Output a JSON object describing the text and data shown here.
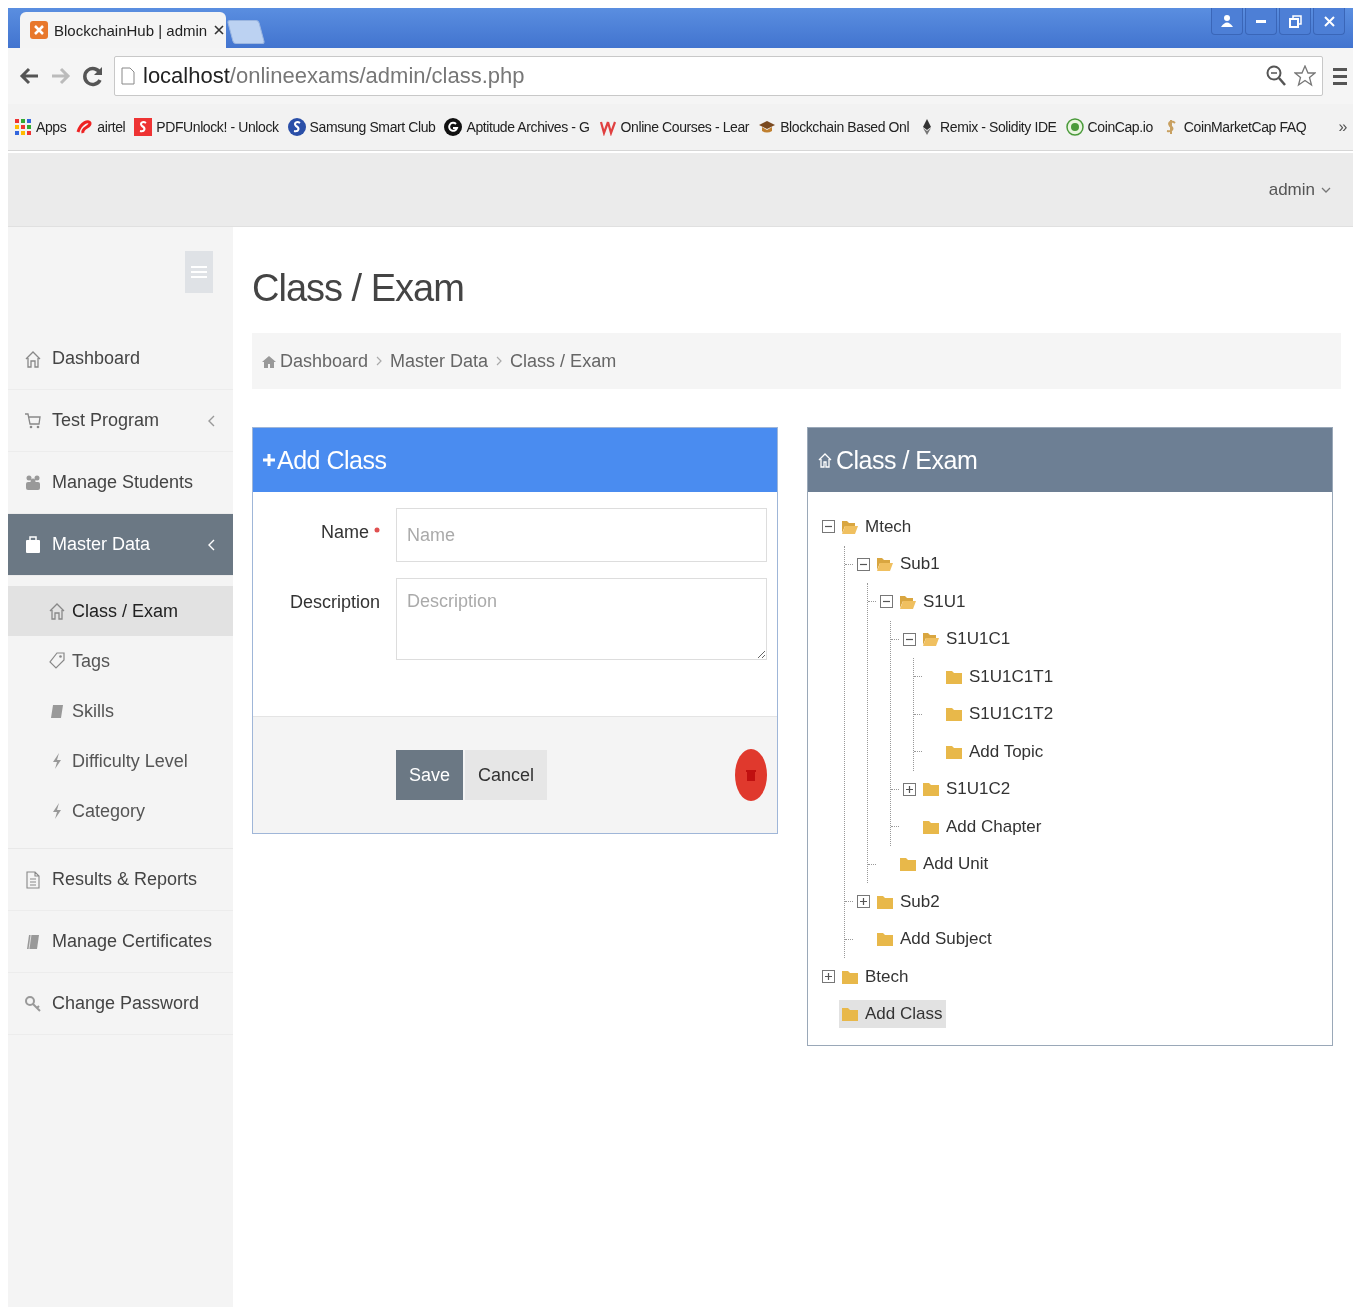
{
  "browser": {
    "tab_title": "BlockchainHub | admin",
    "url_host": "localhost",
    "url_path": "/onlineexams/admin/class.php",
    "more": "»",
    "bookmarks": [
      {
        "label": "Apps"
      },
      {
        "label": "airtel"
      },
      {
        "label": "PDFUnlock! - Unlock"
      },
      {
        "label": "Samsung Smart Club"
      },
      {
        "label": "Aptitude Archives - G"
      },
      {
        "label": "Online Courses - Lear"
      },
      {
        "label": "Blockchain Based Onl"
      },
      {
        "label": "Remix - Solidity IDE"
      },
      {
        "label": "CoinCap.io"
      },
      {
        "label": "CoinMarketCap FAQ"
      }
    ]
  },
  "header": {
    "user": "admin"
  },
  "sidebar": {
    "items": [
      {
        "label": "Dashboard",
        "selected": false,
        "has_submenu": false
      },
      {
        "label": "Test Program",
        "selected": false,
        "has_submenu": true
      },
      {
        "label": "Manage Students",
        "selected": false,
        "has_submenu": false
      },
      {
        "label": "Master Data",
        "selected": true,
        "has_submenu": true,
        "children": [
          {
            "label": "Class / Exam",
            "selected": true
          },
          {
            "label": "Tags",
            "selected": false
          },
          {
            "label": "Skills",
            "selected": false
          },
          {
            "label": "Difficulty Level",
            "selected": false
          },
          {
            "label": "Category",
            "selected": false
          }
        ]
      },
      {
        "label": "Results & Reports",
        "selected": false,
        "has_submenu": false
      },
      {
        "label": "Manage Certificates",
        "selected": false,
        "has_submenu": false
      },
      {
        "label": "Change Password",
        "selected": false,
        "has_submenu": false
      }
    ]
  },
  "page_title": "Class / Exam",
  "breadcrumb": [
    "Dashboard",
    "Master Data",
    "Class / Exam"
  ],
  "form_panel": {
    "title": "Add Class",
    "fields": [
      {
        "kind": "input",
        "label": "Name",
        "required": true,
        "placeholder": "Name"
      },
      {
        "kind": "textarea",
        "label": "Description",
        "required": false,
        "placeholder": "Description"
      }
    ],
    "buttons": [
      {
        "kind": "primary",
        "label": "Save"
      },
      {
        "kind": "default",
        "label": "Cancel"
      }
    ]
  },
  "tree_panel": {
    "title": "Class / Exam",
    "nodes": [
      {
        "label": "Mtech",
        "kind": "branch",
        "expanded": true,
        "selected": false,
        "children": [
          {
            "label": "Sub1",
            "kind": "branch",
            "expanded": true,
            "selected": false,
            "children": [
              {
                "label": "S1U1",
                "kind": "branch",
                "expanded": true,
                "selected": false,
                "children": [
                  {
                    "label": "S1U1C1",
                    "kind": "branch",
                    "expanded": true,
                    "selected": false,
                    "children": [
                      {
                        "label": "S1U1C1T1",
                        "kind": "leaf",
                        "selected": false
                      },
                      {
                        "label": "S1U1C1T2",
                        "kind": "leaf",
                        "selected": false
                      },
                      {
                        "label": "Add Topic",
                        "kind": "leaf",
                        "selected": false
                      }
                    ]
                  },
                  {
                    "label": "S1U1C2",
                    "kind": "branch",
                    "expanded": false,
                    "selected": false
                  },
                  {
                    "label": "Add Chapter",
                    "kind": "leaf",
                    "selected": false
                  }
                ]
              },
              {
                "label": "Add Unit",
                "kind": "leaf",
                "selected": false
              }
            ]
          },
          {
            "label": "Sub2",
            "kind": "branch",
            "expanded": false,
            "selected": false
          },
          {
            "label": "Add Subject",
            "kind": "leaf",
            "selected": false
          }
        ]
      },
      {
        "label": "Btech",
        "kind": "branch",
        "expanded": false,
        "selected": false
      },
      {
        "label": "Add Class",
        "kind": "leaf",
        "selected": true
      }
    ]
  }
}
